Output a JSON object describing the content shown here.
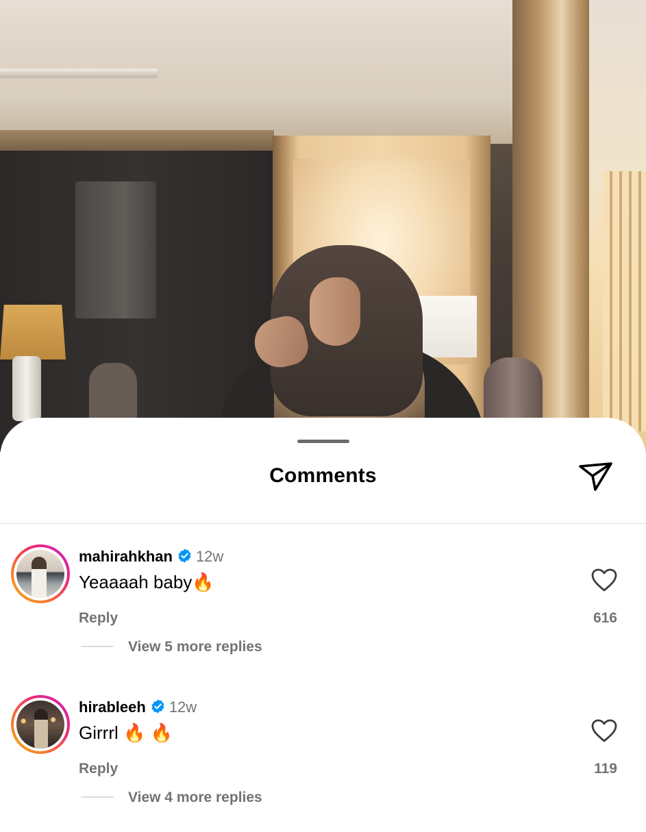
{
  "sheet": {
    "title": "Comments",
    "share_icon": "paper-plane-icon"
  },
  "comments": [
    {
      "username": "mahirahkhan",
      "verified": true,
      "time": "12w",
      "text": "Yeaaaah baby🔥",
      "reply_label": "Reply",
      "likes": "616",
      "view_more": "View 5 more replies"
    },
    {
      "username": "hirableeh",
      "verified": true,
      "time": "12w",
      "text": "Girrrl 🔥 🔥",
      "reply_label": "Reply",
      "likes": "119",
      "view_more": "View 4 more replies"
    }
  ],
  "colors": {
    "secondary_text": "#737373",
    "verified_blue": "#0095f6",
    "divider": "#dbdbdb"
  }
}
